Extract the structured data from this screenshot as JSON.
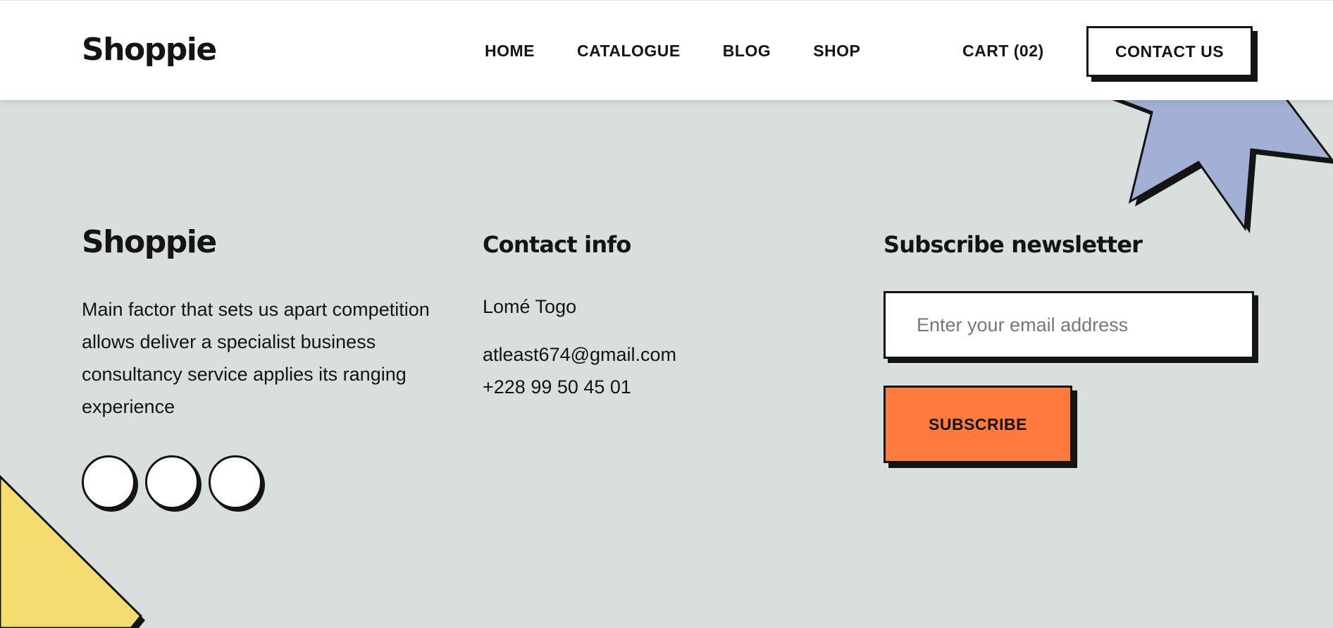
{
  "header": {
    "logo": "Shoppie",
    "nav": [
      "HOME",
      "CATALOGUE",
      "BLOG",
      "SHOP"
    ],
    "cart_label": "CART (02)",
    "contact_button": "CONTACT US"
  },
  "footer": {
    "logo": "Shoppie",
    "about_text": "Main factor that sets us apart competition allows deliver a specialist business consultancy service applies its ranging experience",
    "contact": {
      "heading": "Contact info",
      "location": "Lomé Togo",
      "email": "atleast674@gmail.com",
      "phone": "+228 99 50 45 01"
    },
    "newsletter": {
      "heading": "Subscribe newsletter",
      "email_placeholder": "Enter your email address",
      "subscribe_button": "SUBSCRIBE"
    },
    "social_icons": [
      "social-icon-1",
      "social-icon-2",
      "social-icon-3"
    ]
  },
  "colors": {
    "background": "#d9dfdd",
    "accent_orange": "#ff7a3d",
    "star_blue": "#a2b0d6",
    "triangle_yellow": "#f5dc6e",
    "ink": "#141414"
  }
}
